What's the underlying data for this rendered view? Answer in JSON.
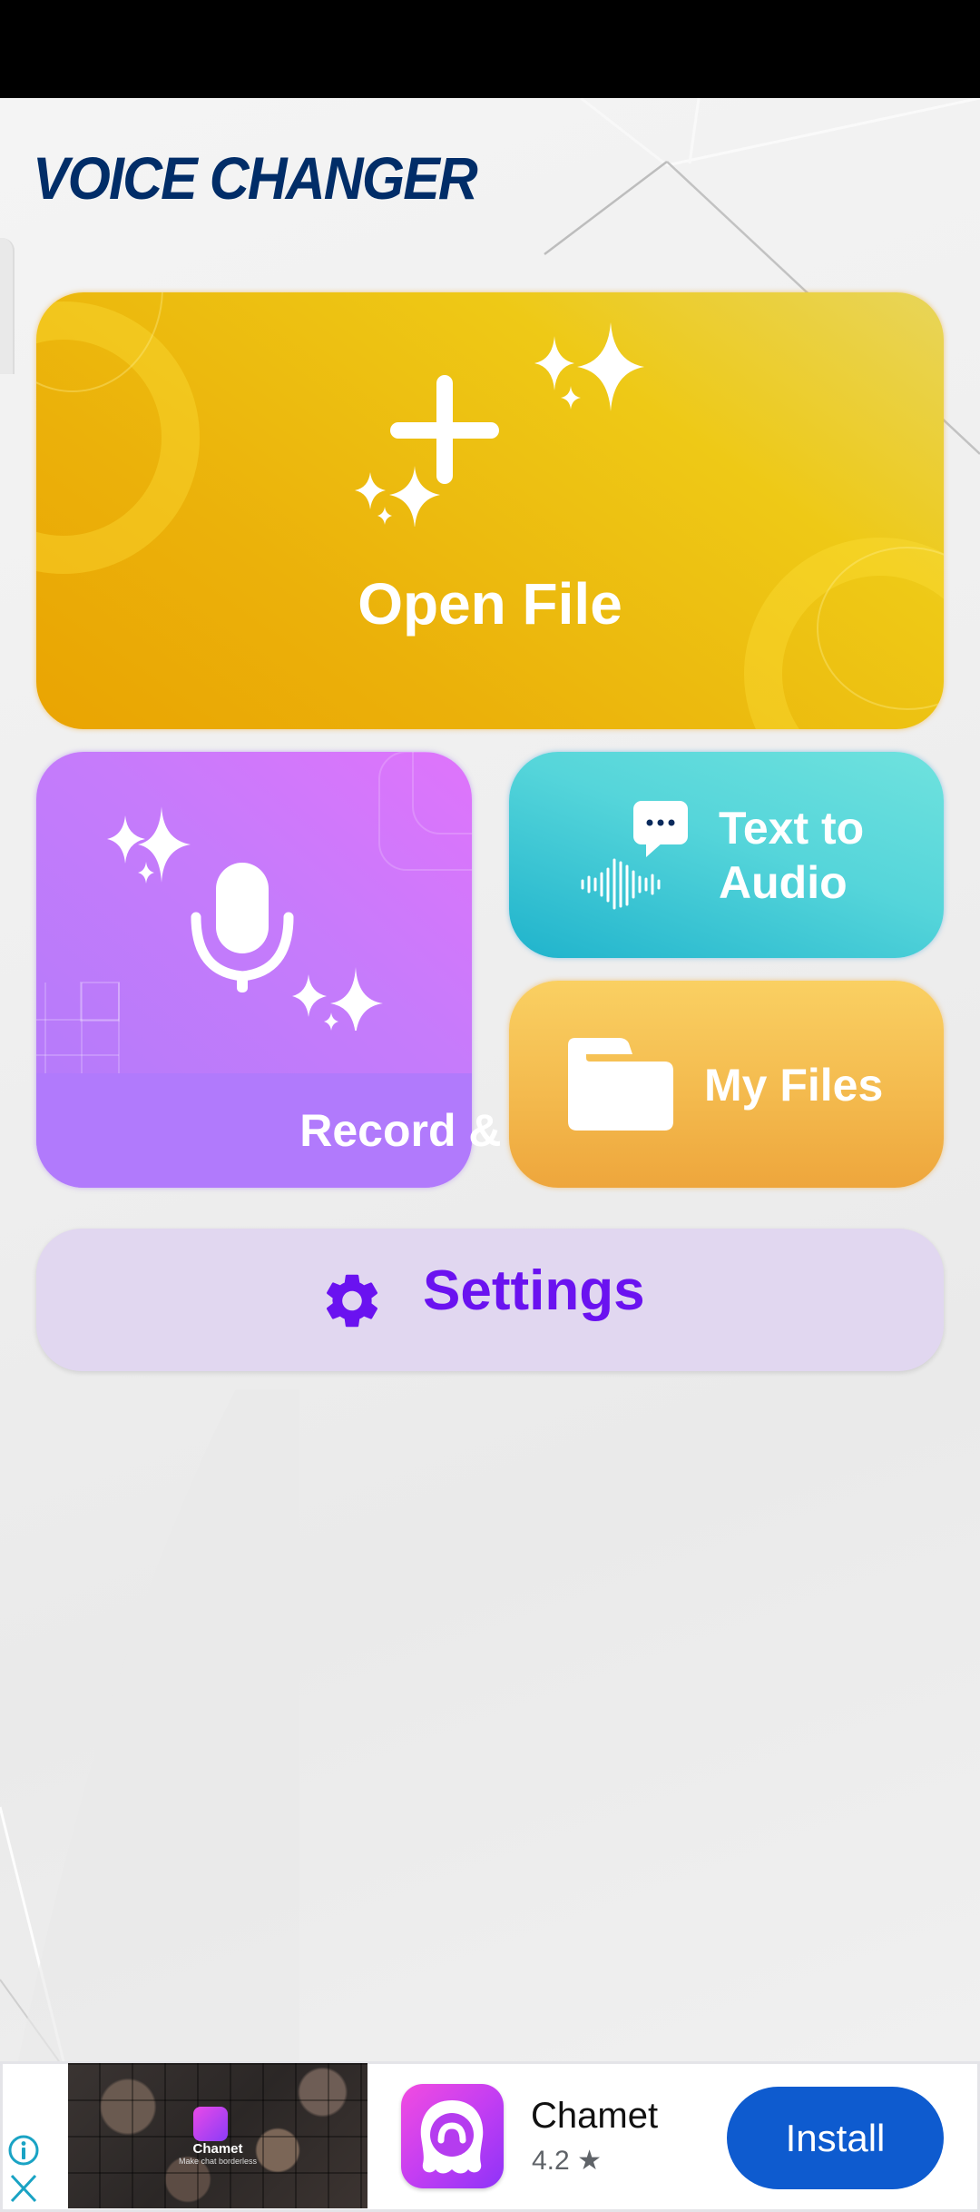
{
  "app": {
    "title": "VOICE CHANGER"
  },
  "colors": {
    "title": "#012d68",
    "open_file_bg": "#eeb80f",
    "record_bg": "#b17afc",
    "text_to_audio_bg": "#3ec8d6",
    "my_files_bg": "#f3b84c",
    "settings_bg": "#e1d7f0",
    "settings_accent": "#6a12f0",
    "install_button": "#0e5bcf",
    "ad_icon_accent": "#1aa3c4"
  },
  "main": {
    "open_file": {
      "label": "Open File",
      "icon": "plus-sparkles-icon"
    },
    "record_change": {
      "label": "Record & Change",
      "icon": "microphone-icon"
    },
    "text_to_audio": {
      "label_line1": "Text to",
      "label_line2": "Audio",
      "icon": "speech-bubble-waveform-icon"
    },
    "my_files": {
      "label": "My Files",
      "icon": "folder-icon"
    },
    "settings": {
      "label": "Settings",
      "icon": "gear-icon"
    }
  },
  "ad": {
    "image_title": "Chamet",
    "image_subtitle": "Make chat borderless",
    "app_name": "Chamet",
    "rating": "4.2",
    "rating_icon": "★",
    "install_label": "Install",
    "info_icon": "info-icon",
    "close_icon": "close-icon"
  }
}
